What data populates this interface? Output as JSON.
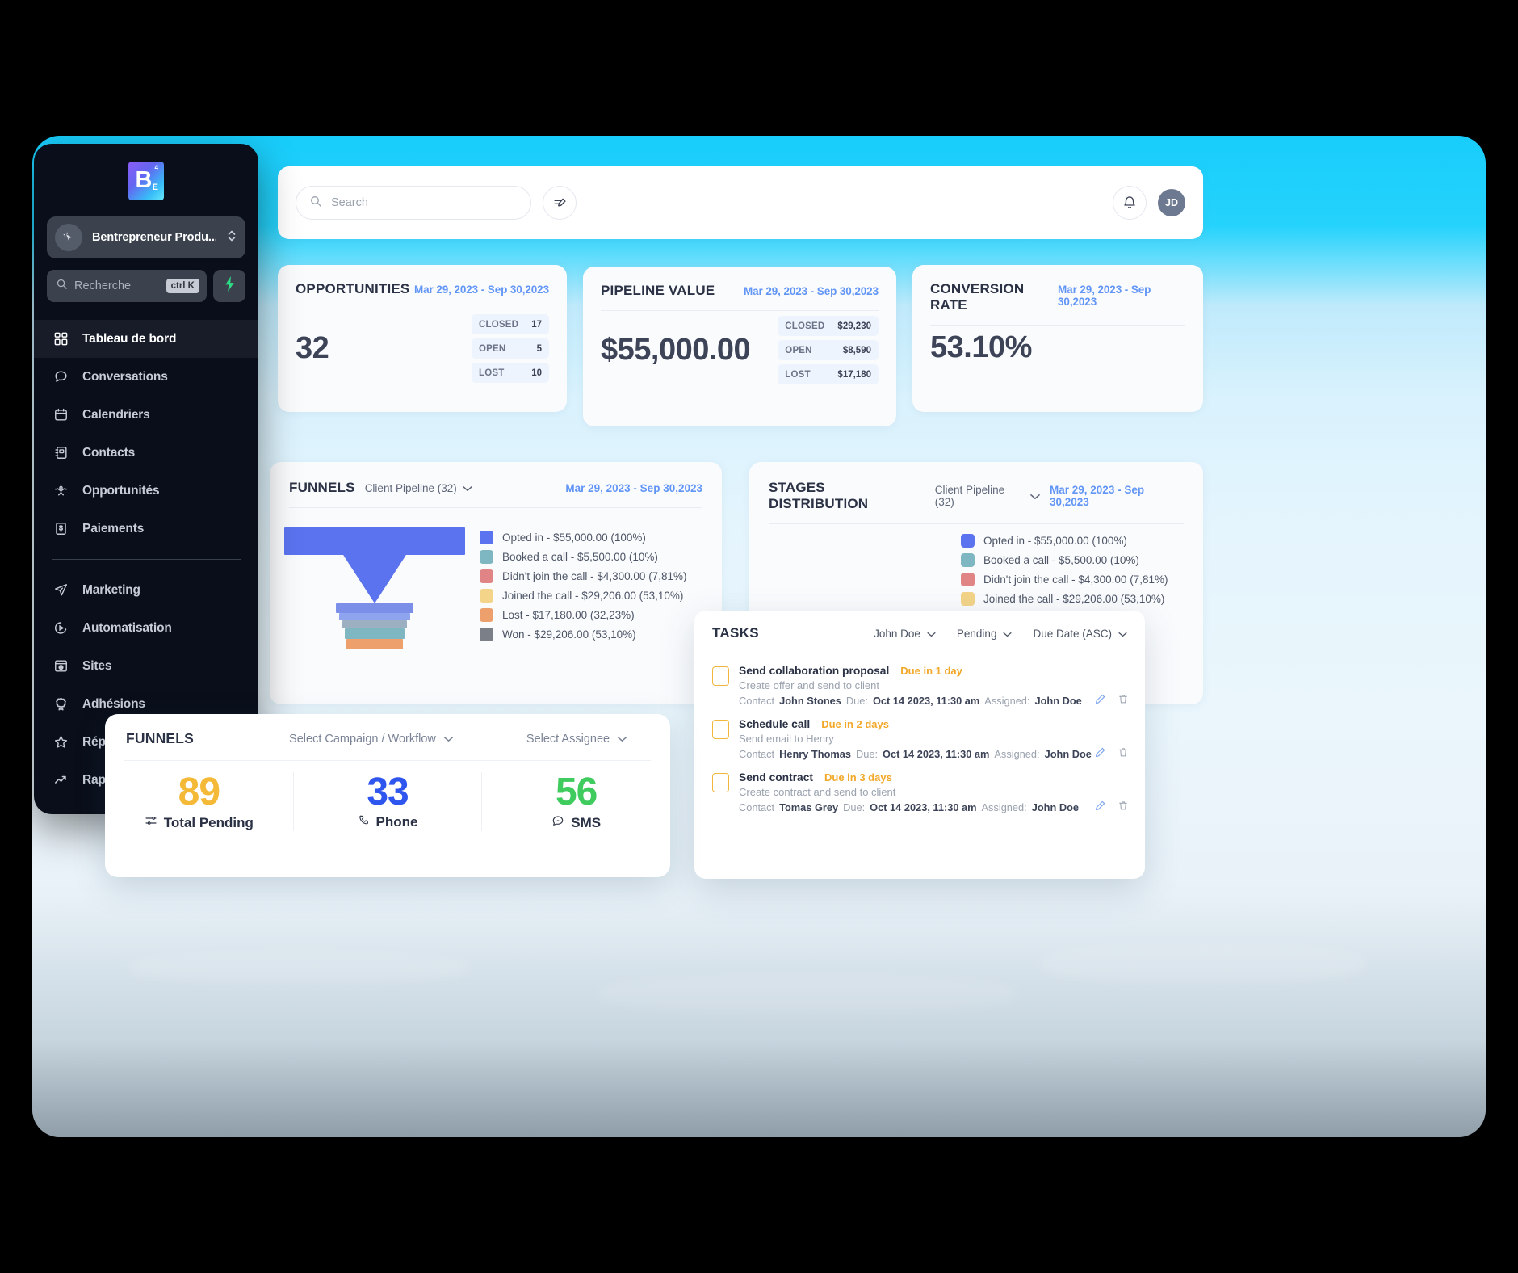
{
  "sidebar": {
    "logo": {
      "letter": "B",
      "sub": "E",
      "sup": "4"
    },
    "account": {
      "name": "Bentrepreneur Produ...",
      "avatar_icon": "cursor-click-icon",
      "chevron_icon": "chevron-updown-icon"
    },
    "search": {
      "placeholder": "Recherche",
      "shortcut": "ctrl K",
      "icon": "search-icon",
      "bolt_icon": "bolt-icon"
    },
    "items": [
      {
        "label": "Tableau de bord",
        "icon": "dashboard-grid-icon",
        "active": true
      },
      {
        "label": "Conversations",
        "icon": "chat-bubble-icon",
        "active": false
      },
      {
        "label": "Calendriers",
        "icon": "calendar-icon",
        "active": false
      },
      {
        "label": "Contacts",
        "icon": "contacts-book-icon",
        "active": false
      },
      {
        "label": "Opportunités",
        "icon": "opportunities-node-icon",
        "active": false
      },
      {
        "label": "Paiements",
        "icon": "payments-receipt-icon",
        "active": false
      }
    ],
    "items2": [
      {
        "label": "Marketing",
        "icon": "paper-plane-icon"
      },
      {
        "label": "Automatisation",
        "icon": "play-circle-icon"
      },
      {
        "label": "Sites",
        "icon": "browser-globe-icon"
      },
      {
        "label": "Adhésions",
        "icon": "ribbon-badge-icon"
      },
      {
        "label": "Réputation",
        "icon": "star-icon"
      },
      {
        "label": "Rapports",
        "icon": "trending-up-icon"
      }
    ]
  },
  "topbar": {
    "search_placeholder": "Search",
    "search_icon": "search-icon",
    "quick_action_icon": "lightning-edit-icon",
    "bell_icon": "bell-icon",
    "avatar_initials": "JD"
  },
  "kpis": [
    {
      "title": "OPPORTUNITIES",
      "range": "Mar 29, 2023 - Sep 30,2023",
      "value": "32",
      "chips": [
        {
          "label": "CLOSED",
          "value": "17"
        },
        {
          "label": "OPEN",
          "value": "5"
        },
        {
          "label": "LOST",
          "value": "10"
        }
      ]
    },
    {
      "title": "PIPELINE VALUE",
      "range": "Mar 29, 2023 - Sep 30,2023",
      "value": "$55,000.00",
      "chips": [
        {
          "label": "CLOSED",
          "value": "$29,230"
        },
        {
          "label": "OPEN",
          "value": "$8,590"
        },
        {
          "label": "LOST",
          "value": "$17,180"
        }
      ]
    },
    {
      "title": "CONVERSION RATE",
      "range": "Mar 29, 2023 - Sep 30,2023",
      "value": "53.10%",
      "chips": []
    }
  ],
  "funnels_panel": {
    "title": "FUNNELS",
    "selector": "Client Pipeline (32)",
    "chevron_icon": "chevron-down-icon",
    "range": "Mar 29, 2023 - Sep 30,2023"
  },
  "stages_panel": {
    "title": "STAGES DISTRIBUTION",
    "selector": "Client Pipeline (32)",
    "chevron_icon": "chevron-down-icon",
    "range": "Mar 29, 2023 - Sep 30,2023"
  },
  "chart_data": {
    "type": "bar",
    "title": "FUNNELS",
    "subtitle": "Client Pipeline (32)",
    "xlabel": "",
    "ylabel": "",
    "orientation": "funnel",
    "categories": [
      "Opted in",
      "Booked a call",
      "Didn't join the call",
      "Joined the call",
      "Lost",
      "Won"
    ],
    "values": [
      55000.0,
      5500.0,
      4300.0,
      29206.0,
      17180.0,
      29206.0
    ],
    "percents": [
      "100%",
      "10%",
      "7,81%",
      "53,10%",
      "32,23%",
      "53,10%"
    ],
    "colors": [
      "#5b73ef",
      "#7eb7c1",
      "#e18486",
      "#f3d488",
      "#eda06b",
      "#7b8088"
    ],
    "legend": [
      {
        "label": "Opted in - $55,000.00 (100%)",
        "color": "#5b73ef"
      },
      {
        "label": "Booked a call - $5,500.00 (10%)",
        "color": "#7eb7c1"
      },
      {
        "label": "Didn't join the call - $4,300.00 (7,81%)",
        "color": "#e18486"
      },
      {
        "label": "Joined the call - $29,206.00 (53,10%)",
        "color": "#f3d488"
      },
      {
        "label": "Lost - $17,180.00 (32,23%)",
        "color": "#eda06b"
      },
      {
        "label": "Won - $29,206.00 (53,10%)",
        "color": "#7b8088"
      }
    ],
    "legend_position": "right",
    "grid": false
  },
  "bottom_funnels": {
    "title": "FUNNELS",
    "select_campaign": "Select Campaign / Workflow",
    "select_assignee": "Select Assignee",
    "chevron_icon": "chevron-down-icon",
    "stats": [
      {
        "number": "89",
        "label": "Total Pending",
        "color": "#f4b937",
        "icon": "sliders-icon"
      },
      {
        "number": "33",
        "label": "Phone",
        "color": "#2f55ef",
        "icon": "phone-icon"
      },
      {
        "number": "56",
        "label": "SMS",
        "color": "#3fcb5e",
        "icon": "sms-icon"
      }
    ]
  },
  "tasks": {
    "title": "TASKS",
    "filters": [
      {
        "label": "John Doe",
        "icon": "chevron-down-icon"
      },
      {
        "label": "Pending",
        "icon": "chevron-down-icon"
      },
      {
        "label": "Due Date (ASC)",
        "icon": "chevron-down-icon"
      }
    ],
    "contact_label": "Contact",
    "due_label": "Due:",
    "assigned_label": "Assigned:",
    "edit_icon": "pencil-icon",
    "delete_icon": "trash-icon",
    "rows": [
      {
        "name": "Send collaboration proposal",
        "due_badge": "Due in 1 day",
        "desc": "Create offer and send to client",
        "contact": "John Stones",
        "due": "Oct 14 2023, 11:30 am",
        "assigned": "John Doe"
      },
      {
        "name": "Schedule call",
        "due_badge": "Due in 2 days",
        "desc": "Send email to Henry",
        "contact": "Henry Thomas",
        "due": "Oct 14 2023, 11:30 am",
        "assigned": "John Doe"
      },
      {
        "name": "Send contract",
        "due_badge": "Due in 3 days",
        "desc": "Create contract and send to client",
        "contact": "Tomas Grey",
        "due": "Oct 14 2023, 11:30 am",
        "assigned": "John Doe"
      }
    ]
  },
  "colors": {
    "accent_blue": "#6296f6",
    "brand_cyan": "#18cdfb",
    "sidebar_bg": "#0a0e1a",
    "due_orange": "#f2a829"
  }
}
